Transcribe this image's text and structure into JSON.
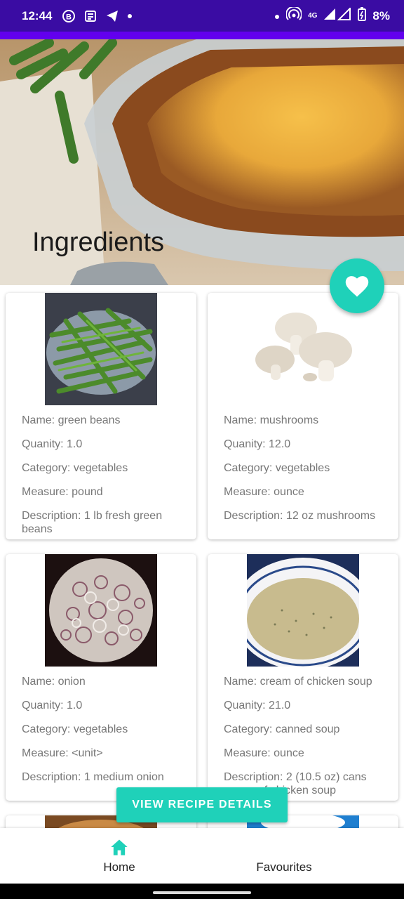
{
  "status_bar": {
    "time": "12:44",
    "network": "4G",
    "battery": "8%",
    "icons": [
      "b-circle-icon",
      "news-icon",
      "telegram-icon",
      "dot-icon",
      "hotspot-icon",
      "signal-icon",
      "battery-icon"
    ]
  },
  "header": {
    "title": "Ingredients"
  },
  "fab": {
    "icon": "heart-icon",
    "color": "#1fd1b9"
  },
  "ingredients": [
    {
      "name": "Name: green beans",
      "quantity": "Quanity: 1.0",
      "category": "Category: vegetables",
      "measure": "Measure: pound",
      "description": "Description: 1 lb fresh green beans"
    },
    {
      "name": "Name: mushrooms",
      "quantity": "Quanity: 12.0",
      "category": "Category: vegetables",
      "measure": "Measure: ounce",
      "description": "Description: 12 oz mushrooms"
    },
    {
      "name": "Name: onion",
      "quantity": "Quanity: 1.0",
      "category": "Category: vegetables",
      "measure": "Measure: <unit>",
      "description": "Description: 1 medium onion"
    },
    {
      "name": "Name: cream of chicken soup",
      "quantity": "Quanity: 21.0",
      "category": "Category: canned soup",
      "measure": "Measure: ounce",
      "description": "Description: 2 (10.5 oz) cans cream of chicken soup"
    }
  ],
  "view_button": {
    "label": "VIEW RECIPE DETAILS"
  },
  "bottom_nav": {
    "home": "Home",
    "favourites": "Favourites"
  },
  "colors": {
    "status_bar": "#3a0ca3",
    "accent": "#1fd1b9",
    "primary": "#6200ee"
  }
}
